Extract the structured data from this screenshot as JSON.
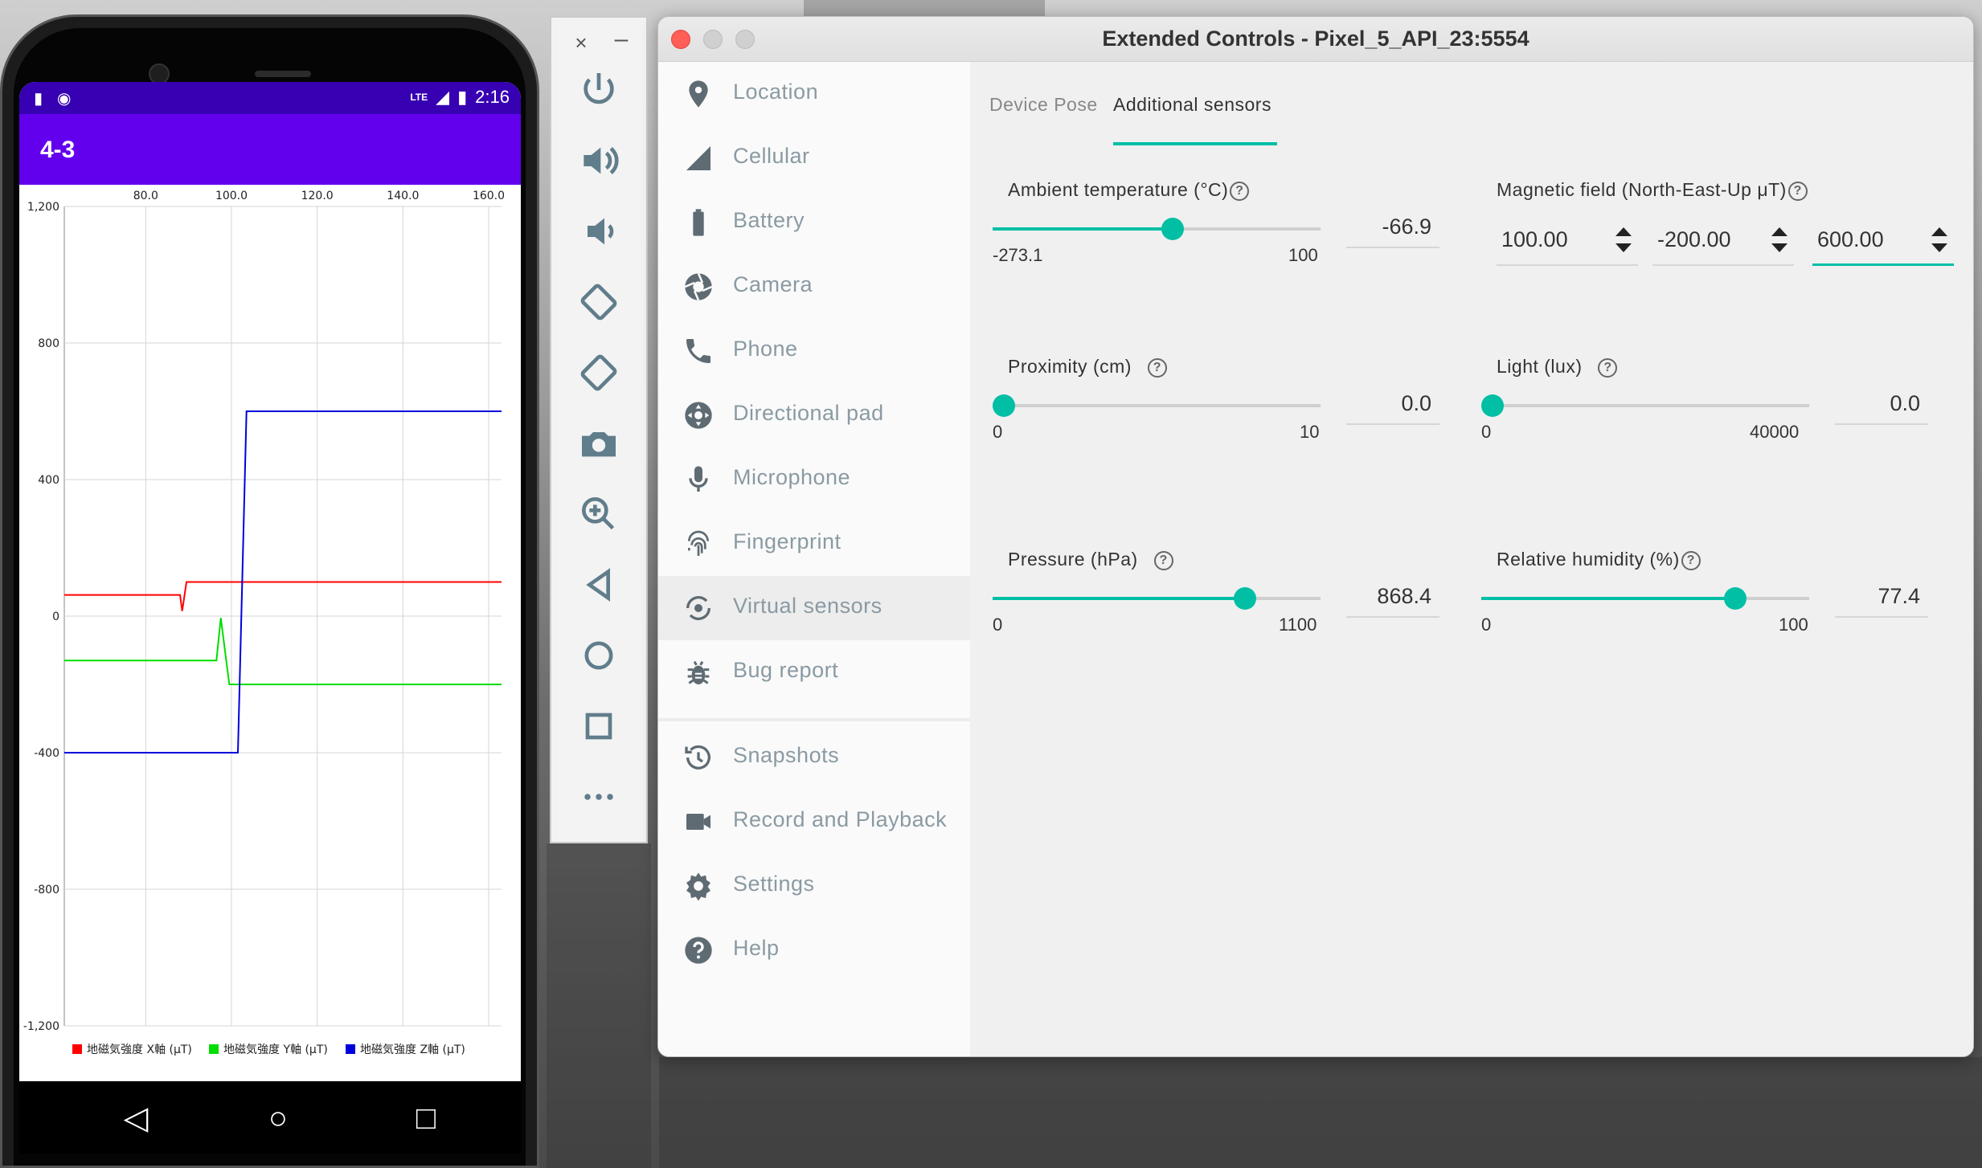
{
  "phone": {
    "status_time": "2:16",
    "status_network": "LTE",
    "app_title": "4-3"
  },
  "chart_data": {
    "type": "line",
    "x_ticks": [
      "80.0",
      "100.0",
      "120.0",
      "140.0",
      "160.0"
    ],
    "y_ticks": [
      "1,200",
      "800",
      "400",
      "0",
      "-400",
      "-800",
      "-1,200"
    ],
    "ylim": [
      -1200,
      1200
    ],
    "xlim": [
      61,
      163
    ],
    "legend_position": "bottom",
    "series": [
      {
        "name": "地磁気強度 X軸 (μT)",
        "color": "#ff0000",
        "x": [
          61,
          88,
          88.5,
          89.5,
          90.5,
          163
        ],
        "y": [
          62,
          62,
          15,
          100,
          100,
          100
        ]
      },
      {
        "name": "地磁気強度 Y軸 (μT)",
        "color": "#00dd00",
        "x": [
          61,
          96.5,
          97.5,
          99.5,
          100.5,
          163
        ],
        "y": [
          -130,
          -130,
          -5,
          -200,
          -200,
          -200
        ]
      },
      {
        "name": "地磁気強度 Z軸 (μT)",
        "color": "#0000dd",
        "x": [
          61,
          101.5,
          103.5,
          163
        ],
        "y": [
          -400,
          -400,
          600,
          600
        ]
      }
    ]
  },
  "toolbar": {
    "close": "×",
    "minimize": "–",
    "buttons": [
      "power-icon",
      "volume-up-icon",
      "volume-down-icon",
      "rotate-left-icon",
      "rotate-right-icon",
      "camera-icon",
      "zoom-icon",
      "back-icon",
      "home-icon",
      "overview-icon",
      "more-icon"
    ]
  },
  "window": {
    "title": "Extended Controls - Pixel_5_API_23:5554",
    "sidebar": [
      {
        "label": "Location",
        "icon": "location-pin-icon"
      },
      {
        "label": "Cellular",
        "icon": "cellular-signal-icon"
      },
      {
        "label": "Battery",
        "icon": "battery-icon"
      },
      {
        "label": "Camera",
        "icon": "camera-aperture-icon"
      },
      {
        "label": "Phone",
        "icon": "phone-icon"
      },
      {
        "label": "Directional pad",
        "icon": "dpad-icon"
      },
      {
        "label": "Microphone",
        "icon": "microphone-icon"
      },
      {
        "label": "Fingerprint",
        "icon": "fingerprint-icon"
      },
      {
        "label": "Virtual sensors",
        "icon": "virtual-sensors-icon"
      },
      {
        "label": "Bug report",
        "icon": "bug-icon"
      },
      {
        "label": "Snapshots",
        "icon": "history-icon"
      },
      {
        "label": "Record and Playback",
        "icon": "video-camera-icon"
      },
      {
        "label": "Settings",
        "icon": "gear-icon"
      },
      {
        "label": "Help",
        "icon": "help-icon"
      }
    ],
    "tabs": [
      "Device Pose",
      "Additional sensors"
    ],
    "sensors": {
      "ambient": {
        "label": "Ambient temperature (°C)",
        "min": "-273.1",
        "max": "100",
        "value": "-66.9"
      },
      "magnetic": {
        "label": "Magnetic field (North-East-Up μT)",
        "x": "100.00",
        "y": "-200.00",
        "z": "600.00"
      },
      "proximity": {
        "label": "Proximity (cm)",
        "min": "0",
        "max": "10",
        "value": "0.0"
      },
      "light": {
        "label": "Light (lux)",
        "min": "0",
        "max": "40000",
        "value": "0.0"
      },
      "pressure": {
        "label": "Pressure (hPa)",
        "min": "0",
        "max": "1100",
        "value": "868.4"
      },
      "humidity": {
        "label": "Relative humidity (%)",
        "min": "0",
        "max": "100",
        "value": "77.4"
      }
    }
  }
}
